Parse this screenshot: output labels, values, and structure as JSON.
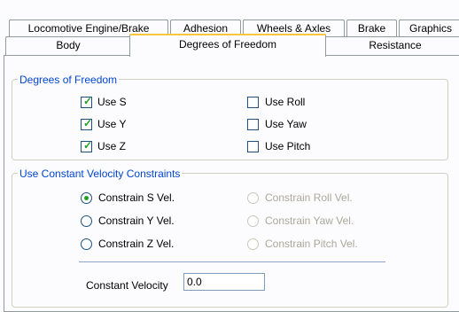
{
  "tabs_row1": [
    {
      "label": "Locomotive Engine/Brake"
    },
    {
      "label": "Adhesion"
    },
    {
      "label": "Wheels & Axles"
    },
    {
      "label": "Brake"
    },
    {
      "label": "Graphics"
    }
  ],
  "tabs_row2": [
    {
      "label": "Body"
    },
    {
      "label": "Degrees of Freedom",
      "active": true
    },
    {
      "label": "Resistance"
    }
  ],
  "dof_group": {
    "title": "Degrees of Freedom",
    "options": [
      {
        "label": "Use S",
        "checked": true
      },
      {
        "label": "Use Y",
        "checked": true
      },
      {
        "label": "Use Z",
        "checked": true
      },
      {
        "label": "Use Roll",
        "checked": false
      },
      {
        "label": "Use Yaw",
        "checked": false
      },
      {
        "label": "Use Pitch",
        "checked": false
      }
    ]
  },
  "cv_group": {
    "title": "Use Constant Velocity Constraints",
    "options": [
      {
        "label": "Constrain S Vel.",
        "selected": true,
        "enabled": true
      },
      {
        "label": "Constrain Y Vel.",
        "selected": false,
        "enabled": true
      },
      {
        "label": "Constrain Z Vel.",
        "selected": false,
        "enabled": true
      },
      {
        "label": "Constrain Roll Vel.",
        "selected": false,
        "enabled": false
      },
      {
        "label": "Constrain Yaw Vel.",
        "selected": false,
        "enabled": false
      },
      {
        "label": "Constrain Pitch Vel.",
        "selected": false,
        "enabled": false
      }
    ],
    "constant_velocity_label": "Constant Velocity",
    "constant_velocity_value": "0.0"
  },
  "colors": {
    "accent_tab": "#ffc83c",
    "legend": "#0046d5",
    "check": "#21a121"
  }
}
